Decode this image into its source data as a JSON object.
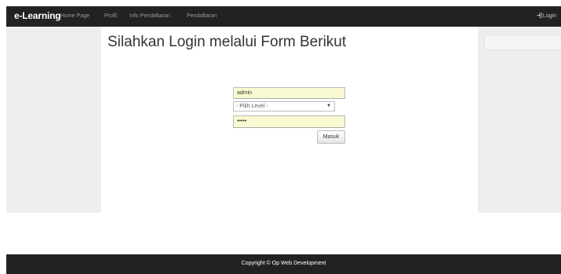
{
  "navbar": {
    "brand": "e-Learning",
    "items": [
      {
        "label": "Home Page"
      },
      {
        "label": "Profil"
      },
      {
        "label": "Info Pendaftaran"
      },
      {
        "label": "Pendaftaran"
      }
    ],
    "login_label": "Login",
    "login_icon": "sign-in-icon"
  },
  "main": {
    "title": "Silahkan Login melalui Form Berikut"
  },
  "form": {
    "username_value": "admin",
    "level_selected": "- Pilih Level -",
    "password_value": "•••••",
    "submit_label": "Masuk"
  },
  "footer": {
    "text": "Copyright © Op Web Development"
  },
  "colors": {
    "navbar_bg": "#222222",
    "sidebar_bg": "#eeeeee",
    "autofill_bg": "#fafad2"
  }
}
